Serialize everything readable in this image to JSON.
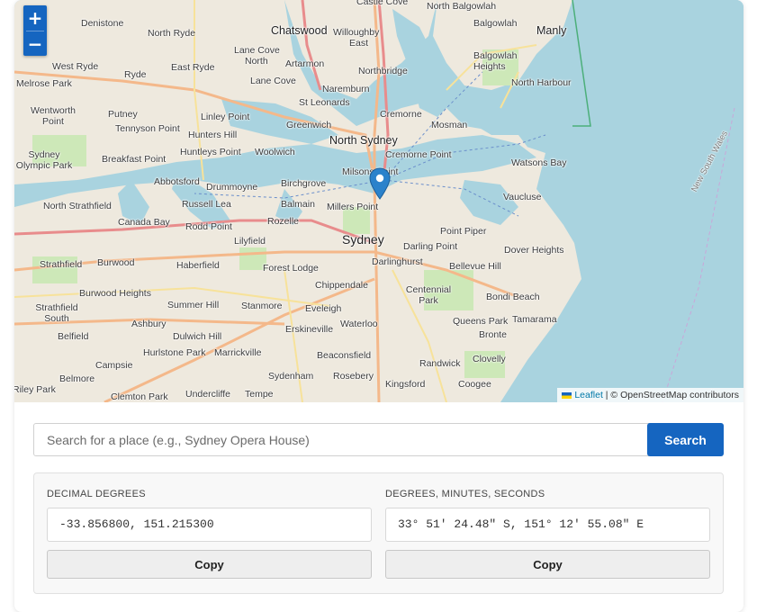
{
  "map": {
    "zoom_in": "+",
    "zoom_out": "−",
    "attribution": {
      "leaflet": "Leaflet",
      "separator": " | © ",
      "osm": "OpenStreetMap contributors"
    },
    "labels": [
      {
        "text": "Castle Cove"
      },
      {
        "text": "North Balgowlah"
      },
      {
        "text": "Denistone"
      },
      {
        "text": "Balgowlah"
      },
      {
        "text": "Chatswood"
      },
      {
        "text": "Manly"
      },
      {
        "text": "North Ryde"
      },
      {
        "text": "Willoughby"
      },
      {
        "text": "East"
      },
      {
        "text": "Lane Cove"
      },
      {
        "text": "North"
      },
      {
        "text": "Balgowlah Heights"
      },
      {
        "text": "West Ryde"
      },
      {
        "text": "East Ryde"
      },
      {
        "text": "Artarmon"
      },
      {
        "text": "Ryde"
      },
      {
        "text": "Northbridge"
      },
      {
        "text": "Melrose Park"
      },
      {
        "text": "Lane Cove"
      },
      {
        "text": "North Harbour"
      },
      {
        "text": "Naremburn"
      },
      {
        "text": "St Leonards"
      },
      {
        "text": "Wentworth Point"
      },
      {
        "text": "Putney"
      },
      {
        "text": "Linley Point"
      },
      {
        "text": "Cremorne"
      },
      {
        "text": "Tennyson Point"
      },
      {
        "text": "Greenwich"
      },
      {
        "text": "Mosman"
      },
      {
        "text": "Hunters Hill"
      },
      {
        "text": "North Sydney"
      },
      {
        "text": "Sydney Olympic Park"
      },
      {
        "text": "Breakfast Point"
      },
      {
        "text": "Huntleys Point"
      },
      {
        "text": "Woolwich"
      },
      {
        "text": "Cremorne Point"
      },
      {
        "text": "Watsons Bay"
      },
      {
        "text": "Milsons Point"
      },
      {
        "text": "Abbotsford"
      },
      {
        "text": "Drummoyne"
      },
      {
        "text": "Birchgrove"
      },
      {
        "text": "Vaucluse"
      },
      {
        "text": "North Strathfield"
      },
      {
        "text": "Russell Lea"
      },
      {
        "text": "Balmain"
      },
      {
        "text": "Millers Point"
      },
      {
        "text": "Canada Bay"
      },
      {
        "text": "Rodd Point"
      },
      {
        "text": "Rozelle"
      },
      {
        "text": "Lilyfield"
      },
      {
        "text": "Sydney"
      },
      {
        "text": "Point Piper"
      },
      {
        "text": "Darling Point"
      },
      {
        "text": "Dover Heights"
      },
      {
        "text": "Strathfield"
      },
      {
        "text": "Burwood"
      },
      {
        "text": "Haberfield"
      },
      {
        "text": "Forest Lodge"
      },
      {
        "text": "Darlinghurst"
      },
      {
        "text": "Bellevue Hill"
      },
      {
        "text": "Burwood Heights"
      },
      {
        "text": "Chippendale"
      },
      {
        "text": "Centennial Park"
      },
      {
        "text": "Bondi Beach"
      },
      {
        "text": "Strathfield South"
      },
      {
        "text": "Summer Hill"
      },
      {
        "text": "Stanmore"
      },
      {
        "text": "Eveleigh"
      },
      {
        "text": "Ashbury"
      },
      {
        "text": "Waterloo"
      },
      {
        "text": "Queens Park"
      },
      {
        "text": "Tamarama"
      },
      {
        "text": "Belfield"
      },
      {
        "text": "Dulwich Hill"
      },
      {
        "text": "Erskineville"
      },
      {
        "text": "Bronte"
      },
      {
        "text": "Hurlstone Park"
      },
      {
        "text": "Marrickville"
      },
      {
        "text": "Beaconsfield"
      },
      {
        "text": "Campsie"
      },
      {
        "text": "Clovelly"
      },
      {
        "text": "Randwick"
      },
      {
        "text": "Sydenham"
      },
      {
        "text": "Rosebery"
      },
      {
        "text": "Belmore"
      },
      {
        "text": "Kingsford"
      },
      {
        "text": "Coogee"
      },
      {
        "text": "Riley Park"
      },
      {
        "text": "Clemton Park"
      },
      {
        "text": "Undercliffe"
      },
      {
        "text": "Tempe"
      },
      {
        "text": "New South Wales"
      }
    ]
  },
  "search": {
    "placeholder": "Search for a place (e.g., Sydney Opera House)",
    "button": "Search"
  },
  "coordinates": {
    "decimal": {
      "label": "DECIMAL DEGREES",
      "value": "-33.856800, 151.215300",
      "copy": "Copy"
    },
    "dms": {
      "label": "DEGREES, MINUTES, SECONDS",
      "value": "33° 51' 24.48\" S, 151° 12' 55.08\" E",
      "copy": "Copy"
    }
  },
  "colors": {
    "accent": "#1565c0",
    "water": "#a9d3df",
    "land": "#eee9de",
    "marker": "#2b82cb"
  }
}
